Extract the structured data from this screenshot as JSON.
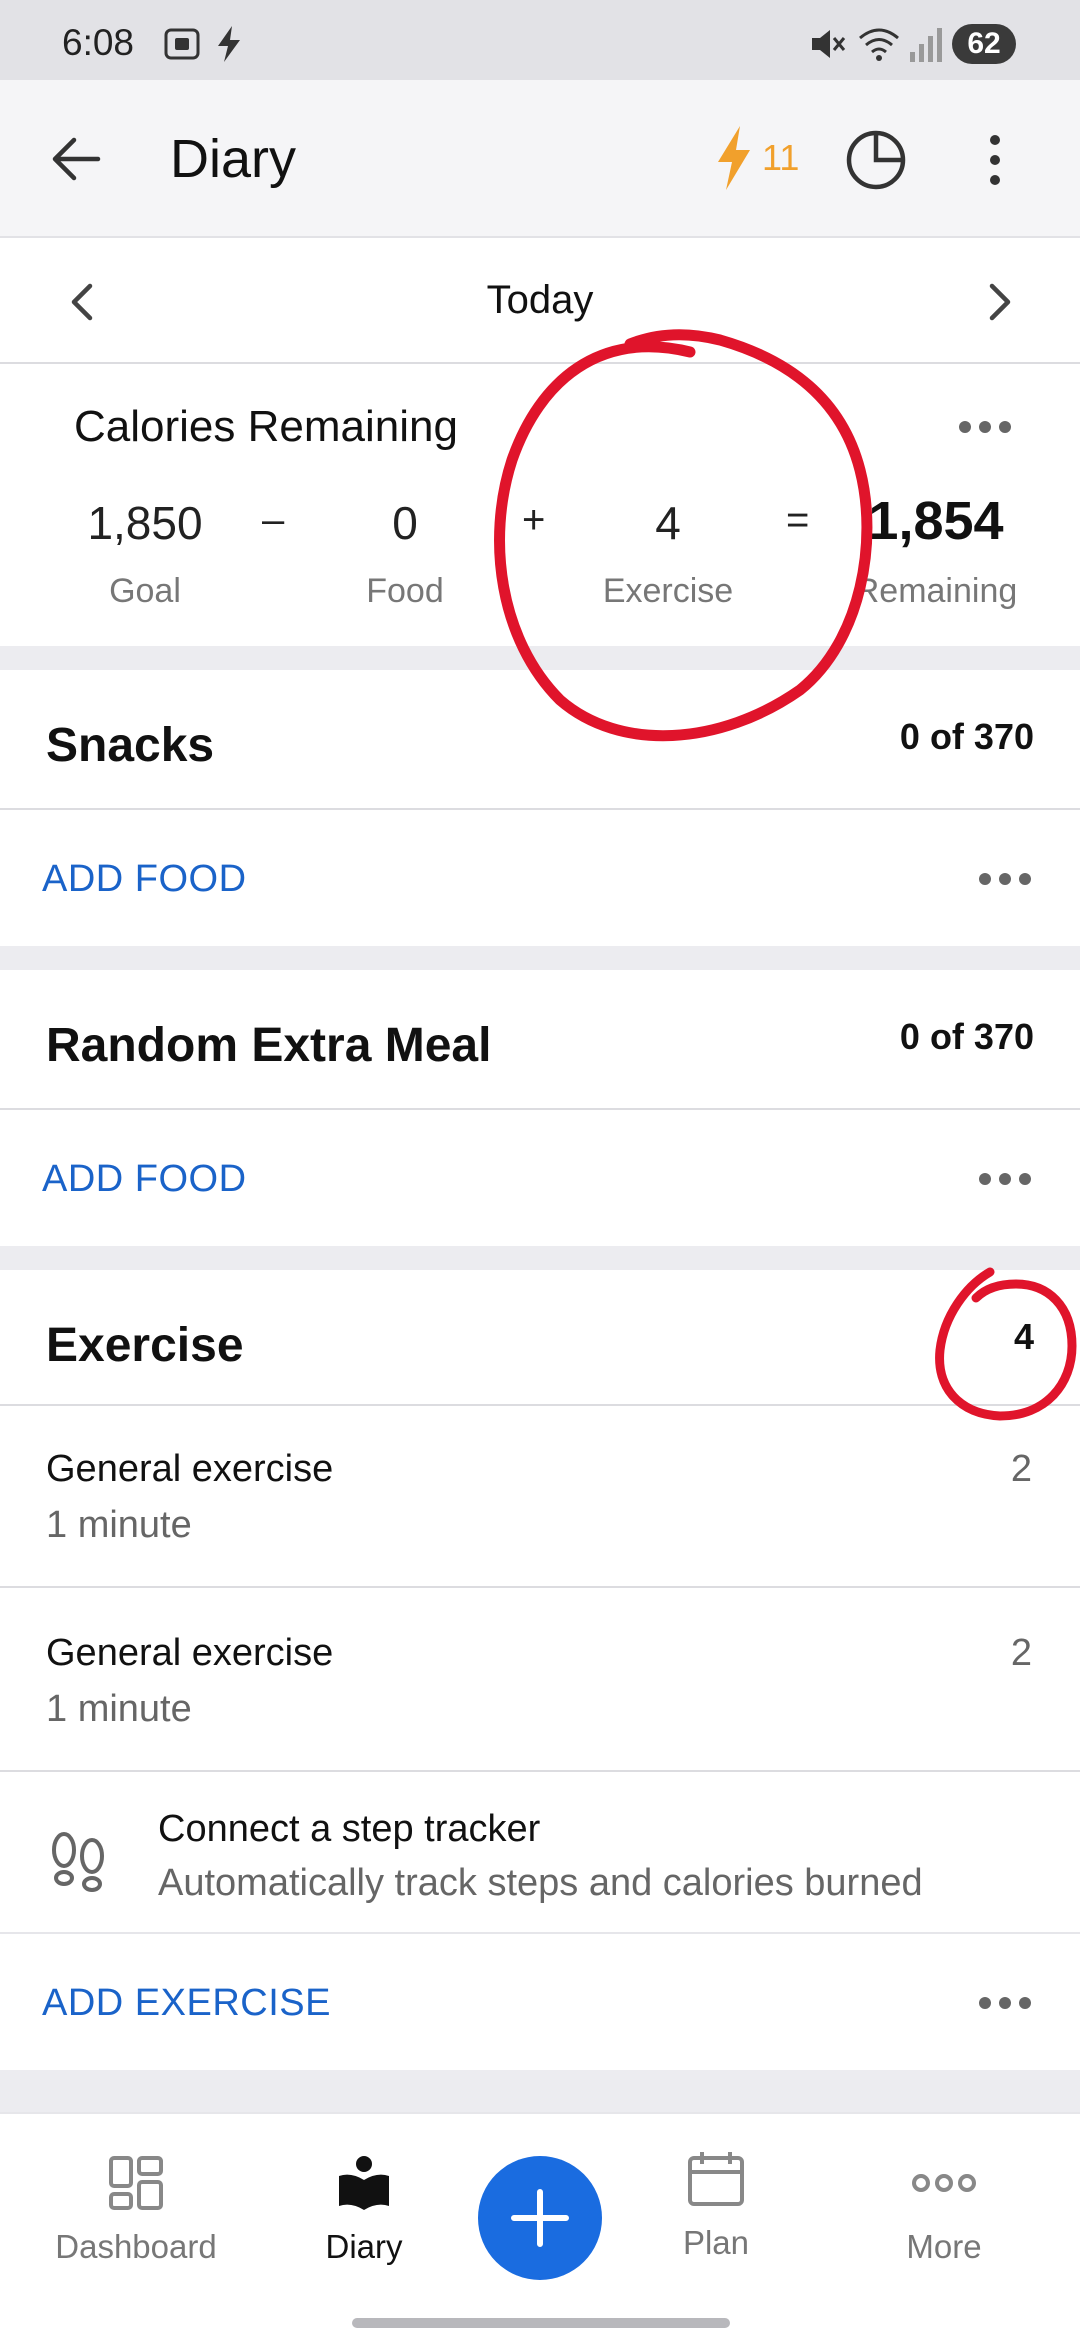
{
  "status_bar": {
    "time": "6:08",
    "battery": "62",
    "icons": [
      "screenshot-icon",
      "charging-bolt-icon",
      "mute-icon",
      "wifi-icon",
      "signal-icon",
      "battery-icon"
    ]
  },
  "app_bar": {
    "title": "Diary",
    "streak_count": "11",
    "colors": {
      "streak": "#f1a02c"
    }
  },
  "date_nav": {
    "label": "Today"
  },
  "calories": {
    "title": "Calories Remaining",
    "goal_value": "1,850",
    "goal_label": "Goal",
    "minus": "–",
    "food_value": "0",
    "food_label": "Food",
    "plus": "+",
    "exercise_value": "4",
    "exercise_label": "Exercise",
    "equals": "=",
    "remaining_value": "1,854",
    "remaining_label": "Remaining"
  },
  "sections": {
    "snacks": {
      "title": "Snacks",
      "value": "0 of 370",
      "add_label": "ADD FOOD"
    },
    "extra_meal": {
      "title": "Random Extra Meal",
      "value": "0 of 370",
      "add_label": "ADD FOOD"
    },
    "exercise": {
      "title": "Exercise",
      "value": "4",
      "items": [
        {
          "name": "General exercise",
          "duration": "1 minute",
          "calories": "2"
        },
        {
          "name": "General exercise",
          "duration": "1 minute",
          "calories": "2"
        }
      ],
      "tracker_title": "Connect a step tracker",
      "tracker_subtitle": "Automatically track steps and calories burned",
      "add_label": "ADD EXERCISE"
    }
  },
  "bottom_nav": {
    "dashboard": "Dashboard",
    "diary": "Diary",
    "plan": "Plan",
    "more": "More"
  },
  "colors": {
    "accent": "#1a63c9",
    "fab": "#1a6ce0",
    "annotation": "#e0142b"
  }
}
